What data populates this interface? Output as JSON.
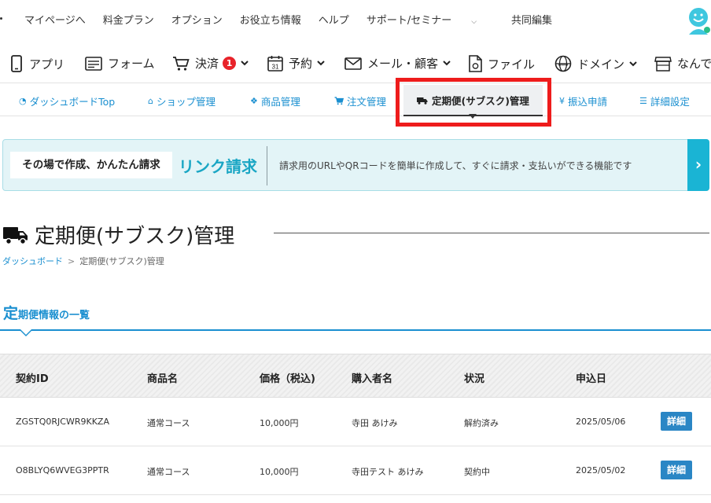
{
  "top_nav": {
    "links": [
      "マイページへ",
      "料金プラン",
      "オプション",
      "お役立ち情報",
      "ヘルプ",
      "サポート/セミナー",
      "共同編集"
    ]
  },
  "main_menu": {
    "items": [
      {
        "label": "アプリ",
        "icon": "smartphone-icon"
      },
      {
        "label": "フォーム",
        "icon": "form-icon"
      },
      {
        "label": "決済",
        "icon": "cart-icon",
        "badge": "1"
      },
      {
        "label": "予約",
        "icon": "calendar-icon"
      },
      {
        "label": "メール・顧客",
        "icon": "mail-icon"
      },
      {
        "label": "ファイル",
        "icon": "file-icon"
      },
      {
        "label": "ドメイン",
        "icon": "globe-icon"
      },
      {
        "label": "なんで",
        "icon": "store-icon"
      }
    ]
  },
  "sub_menu": {
    "items": [
      {
        "label": "ダッシュボードTop",
        "icon": "dashboard-icon"
      },
      {
        "label": "ショップ管理",
        "icon": "home-icon"
      },
      {
        "label": "商品管理",
        "icon": "cubes-icon"
      },
      {
        "label": "注文管理",
        "icon": "cart-icon"
      },
      {
        "label": "定期便(サブスク)管理",
        "icon": "truck-icon",
        "active": true
      },
      {
        "label": "振込申請",
        "icon": "yen-icon"
      },
      {
        "label": "詳細設定",
        "icon": "list-icon"
      }
    ]
  },
  "banner": {
    "lead": "その場で作成、かんたん請求",
    "title": "リンク請求",
    "description": "請求用のURLやQRコードを簡単に作成して、すぐに請求・支払いができる機能です",
    "arrow": "›"
  },
  "page": {
    "title": "定期便(サブスク)管理",
    "breadcrumb": {
      "home": "ダッシュボード",
      "separator": ">",
      "current": "定期便(サブスク)管理"
    },
    "section_title_first": "定",
    "section_title_rest": "期便情報の一覧"
  },
  "table": {
    "headers": [
      "契約ID",
      "商品名",
      "価格（税込)",
      "購入者名",
      "状況",
      "申込日"
    ],
    "rows": [
      {
        "id": "ZGSTQ0RJCWR9KKZA",
        "product": "通常コース",
        "price": "10,000円",
        "buyer": "寺田 あけみ",
        "status": "解約済み",
        "date": "2025/05/06",
        "action": "詳細"
      },
      {
        "id": "O8BLYQ6WVEG3PPTR",
        "product": "通常コース",
        "price": "10,000円",
        "buyer": "寺田テスト あけみ",
        "status": "契約中",
        "date": "2025/05/02",
        "action": "詳細"
      }
    ]
  },
  "colors": {
    "link_blue": "#1a8fd0",
    "accent_cyan": "#1aa6c4",
    "badge_red": "#e8232a",
    "highlight_red": "#ee1c1c",
    "button_blue": "#2a86c5"
  }
}
